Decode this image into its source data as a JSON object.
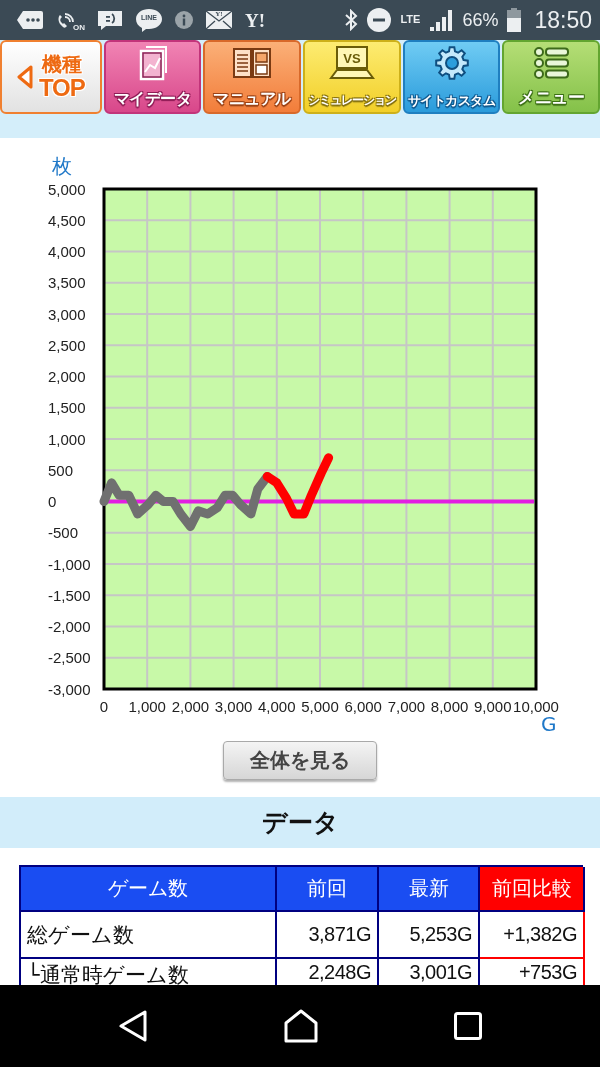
{
  "status_bar": {
    "wifi_call_badge": "ON",
    "chat_app_label": "LINE",
    "mail_badge": "Y!",
    "logo_text": "Y!",
    "network": "LTE",
    "battery": "66%",
    "time": "18:50"
  },
  "nav_buttons": [
    {
      "kind": "top",
      "lines": [
        "機種",
        "TOP"
      ]
    },
    {
      "kind": "data",
      "label": "マイデータ"
    },
    {
      "kind": "manual",
      "label": "マニュアル"
    },
    {
      "kind": "simulation",
      "label": "シミュレーション",
      "icon_text": "VS"
    },
    {
      "kind": "custom",
      "label": "サイトカスタム"
    },
    {
      "kind": "menu",
      "label": "メニュー"
    }
  ],
  "chart": {
    "chart_data": {
      "type": "line",
      "ylabel": "枚",
      "xlabel": "G",
      "grid": true,
      "x": [
        0,
        175,
        350,
        575,
        780,
        1020,
        1200,
        1375,
        1600,
        1775,
        2000,
        2180,
        2400,
        2620,
        2800,
        2980,
        3160,
        3400,
        3560,
        3780,
        4000,
        4225,
        4400,
        4625,
        4800,
        5025,
        5200
      ],
      "series": [
        {
          "color": "#707070",
          "values": [
            0,
            300,
            100,
            100,
            -200,
            -50,
            100,
            0,
            0,
            -200,
            -400,
            -150,
            -200,
            -100,
            100,
            100,
            -50,
            -200,
            200,
            400,
            null,
            null,
            null,
            null,
            null,
            null,
            null
          ]
        },
        {
          "color": "#ff0000",
          "values": [
            null,
            null,
            null,
            null,
            null,
            null,
            null,
            null,
            null,
            null,
            null,
            null,
            null,
            null,
            null,
            null,
            null,
            null,
            null,
            400,
            300,
            50,
            -200,
            -200,
            100,
            450,
            700
          ]
        }
      ],
      "xlim": [
        0,
        10000
      ],
      "ylim": [
        -3000,
        5000
      ],
      "xticks": [
        {
          "value": 0,
          "label": "0"
        },
        {
          "value": 1000,
          "label": "1,000"
        },
        {
          "value": 2000,
          "label": "2,000"
        },
        {
          "value": 3000,
          "label": "3,000"
        },
        {
          "value": 4000,
          "label": "4,000"
        },
        {
          "value": 5000,
          "label": "5,000"
        },
        {
          "value": 6000,
          "label": "6,000"
        },
        {
          "value": 7000,
          "label": "7,000"
        },
        {
          "value": 8000,
          "label": "8,000"
        },
        {
          "value": 9000,
          "label": "9,000"
        },
        {
          "value": 10000,
          "label": "10,000"
        }
      ],
      "yticks": [
        {
          "value": 5000,
          "label": "5,000"
        },
        {
          "value": 4500,
          "label": "4,500"
        },
        {
          "value": 4000,
          "label": "4,000"
        },
        {
          "value": 3500,
          "label": "3,500"
        },
        {
          "value": 3000,
          "label": "3,000"
        },
        {
          "value": 2500,
          "label": "2,500"
        },
        {
          "value": 2000,
          "label": "2,000"
        },
        {
          "value": 1500,
          "label": "1,500"
        },
        {
          "value": 1000,
          "label": "1,000"
        },
        {
          "value": 500,
          "label": "500"
        },
        {
          "value": 0,
          "label": "0"
        },
        {
          "value": -500,
          "label": "-500"
        },
        {
          "value": -1000,
          "label": "-1,000"
        },
        {
          "value": -1500,
          "label": "-1,500"
        },
        {
          "value": -2000,
          "label": "-2,000"
        },
        {
          "value": -2500,
          "label": "-2,500"
        },
        {
          "value": -3000,
          "label": "-3,000"
        }
      ],
      "ref_lines": [
        {
          "axis": "y",
          "value": 0,
          "color": "#e21ee2"
        }
      ]
    }
  },
  "view_all_button": "全体を見る",
  "data_section": {
    "title": "データ",
    "table": {
      "columns": [
        {
          "label": "ゲーム数",
          "color": "#1a4df2"
        },
        {
          "label": "前回",
          "color": "#1a4df2"
        },
        {
          "label": "最新",
          "color": "#1a4df2"
        },
        {
          "label": "前回比較",
          "color": "#ff0000"
        }
      ],
      "rows": [
        {
          "cells": [
            "総ゲーム数",
            "3,871G",
            "5,253G",
            "+1,382G"
          ]
        },
        {
          "cells": [
            "└通常時ゲーム数",
            "2,248G",
            "3,001G",
            "+753G"
          ]
        }
      ]
    }
  }
}
